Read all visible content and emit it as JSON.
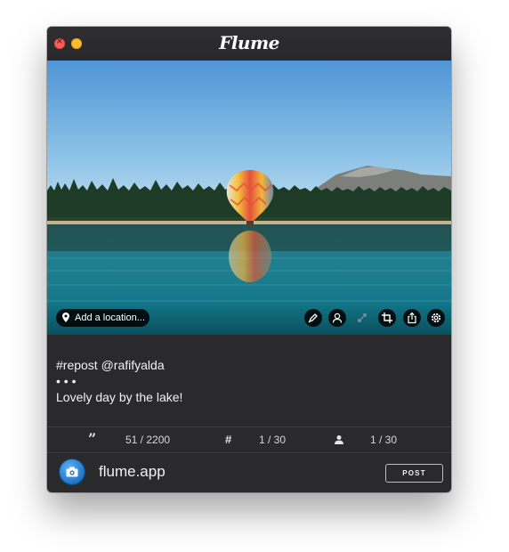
{
  "app": {
    "name": "Flume"
  },
  "photo": {
    "location_button": "Add a location...",
    "tools": [
      "pen-icon",
      "user-tag-icon",
      "resize-icon",
      "crop-icon",
      "share-icon",
      "gear-icon"
    ]
  },
  "caption": {
    "lines": [
      "#repost @rafifyalda",
      "• • •",
      "Lovely day by the lake!"
    ]
  },
  "counters": {
    "characters": "51 / 2200",
    "hashtags": "1 / 30",
    "mentions": "1 / 30"
  },
  "footer": {
    "account": "flume.app",
    "post_label": "POST"
  },
  "colors": {
    "window_bg": "#2a2a2c",
    "close": "#fc5f57",
    "minimize": "#fdbc2e",
    "avatar": "#1e73c8"
  }
}
